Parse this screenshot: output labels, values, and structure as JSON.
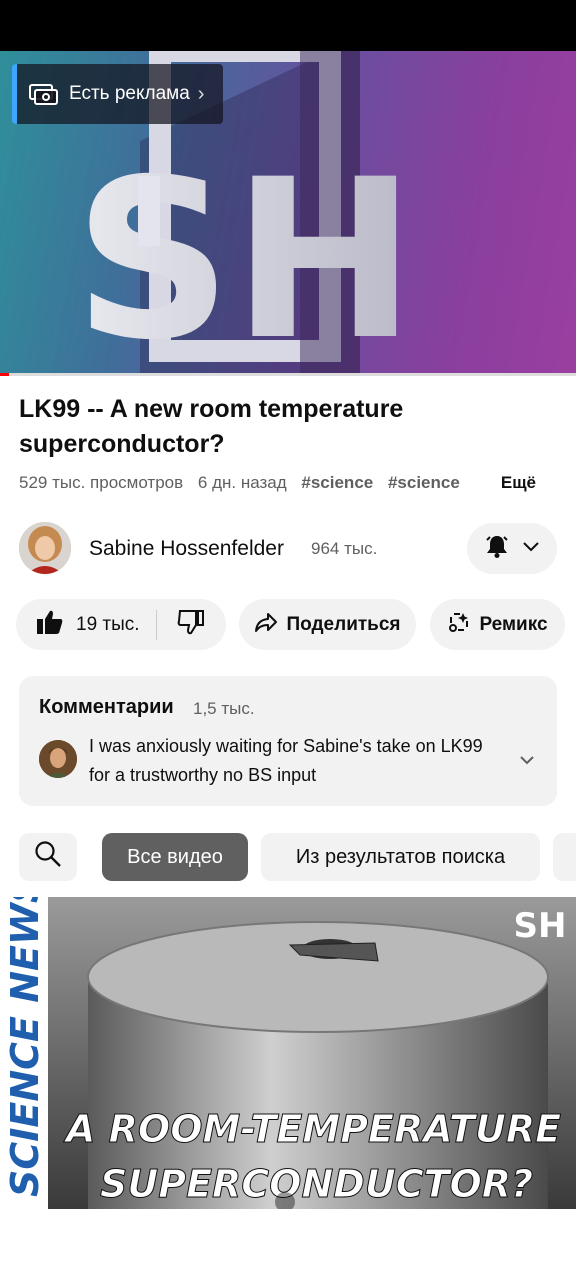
{
  "ad": {
    "label": "Есть реклама",
    "icon": "ad-cash-icon"
  },
  "player": {
    "watermark": "SH",
    "progress_fraction": 0.015
  },
  "video": {
    "title": "LK99 -- A new room temperature superconductor?",
    "views": "529 тыс. просмотров",
    "age": "6 дн. назад",
    "tags": [
      "#science",
      "#science"
    ],
    "more": "Ещё"
  },
  "channel": {
    "name": "Sabine Hossenfelder",
    "subscribers": "964 тыс."
  },
  "actions": {
    "likes": "19 тыс.",
    "share": "Поделиться",
    "remix": "Ремикс"
  },
  "comments": {
    "title": "Комментарии",
    "count": "1,5 тыс.",
    "top_comment": "I was anxiously waiting for Sabine's take on LK99 for a trustworthy no BS input"
  },
  "filters": [
    "Все видео",
    "Из результатов поиска"
  ],
  "next_video": {
    "side_text": "SCIENCE NEWS",
    "line1": "A ROOM-TEMPERATURE",
    "line2": "SUPERCONDUCTOR?",
    "logo": "SH"
  },
  "colors": {
    "accent": "#3ea6ff",
    "progress": "#ff0000",
    "chip_selected": "#606060",
    "chip_bg": "#f2f2f2"
  }
}
